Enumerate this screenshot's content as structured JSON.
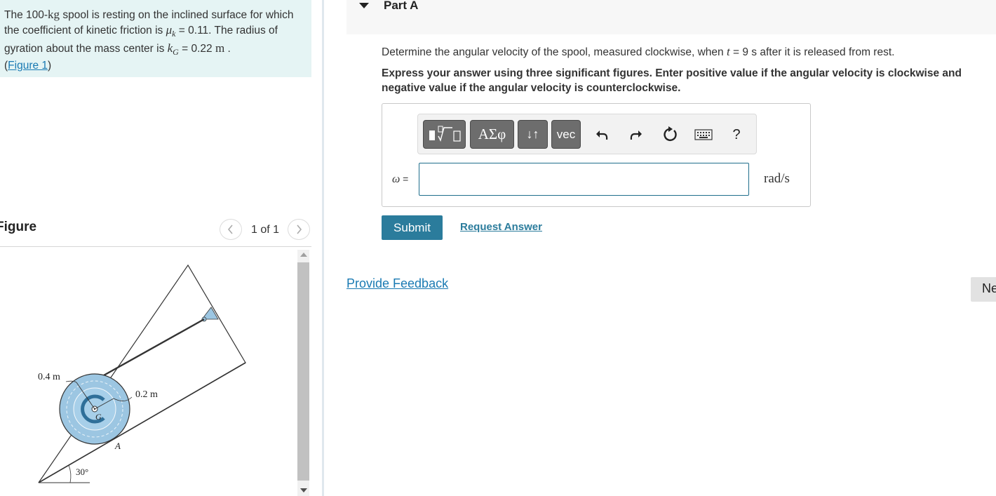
{
  "problem": {
    "text_1": "The 100-",
    "mass_unit": "kg",
    "text_2": " spool is resting on the inclined surface for which the coefficient of kinetic friction is ",
    "mu_symbol": "μ",
    "mu_sub": "k",
    "mu_value": " = 0.11. The radius of gyration about the mass center is ",
    "k_symbol": "k",
    "k_sub": "G",
    "k_value": " = 0.22 ",
    "k_unit": "m",
    "period": " .",
    "figure_link_open": "(",
    "figure_link": "Figure 1",
    "figure_link_close": ")"
  },
  "figure": {
    "title": "Figure",
    "prev_icon": "chevron-left-icon",
    "next_icon": "chevron-right-icon",
    "pager": "1 of 1",
    "labels": {
      "outer_radius": "0.4 m",
      "inner_radius": "0.2 m",
      "center": "G",
      "contact": "A",
      "angle": "30°"
    }
  },
  "part": {
    "title": "Part A",
    "question_1": "Determine the angular velocity of the spool, measured clockwise, when ",
    "question_t": "t",
    "question_2": " = 9  s after it is released from rest.",
    "instructions": "Express your answer using three significant figures. Enter positive value if the angular velocity is clockwise and negative value if the angular velocity is counterclockwise."
  },
  "toolbar": {
    "templates_icon": "templates-icon",
    "greek_label": "ΑΣφ",
    "arrows_label": "↓↑",
    "vec_label": "vec",
    "undo_icon": "undo-icon",
    "redo_icon": "redo-icon",
    "reset_icon": "reset-icon",
    "keyboard_icon": "keyboard-icon",
    "help_label": "?"
  },
  "answer": {
    "variable": "ω",
    "equals": " =",
    "value": "",
    "units": "rad/s"
  },
  "actions": {
    "submit": "Submit",
    "request_answer": "Request Answer",
    "provide_feedback": "Provide Feedback",
    "next": "Ne"
  },
  "colors": {
    "problem_bg": "#e5f4f4",
    "accent": "#2b7c9c",
    "link": "#1a7ab3",
    "spool": "#9cc6e2"
  }
}
